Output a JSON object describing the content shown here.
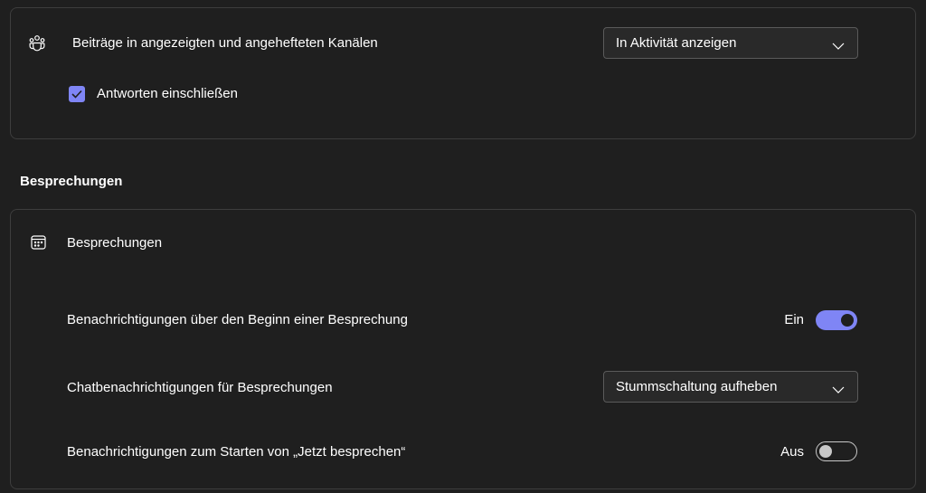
{
  "channels_card": {
    "icon": "teams-people-icon",
    "label": "Beiträge in angezeigten und angehefteten Kanälen",
    "dropdown_value": "In Aktivität anzeigen",
    "checkbox_label": "Antworten einschließen",
    "checkbox_checked": true
  },
  "meetings_section": {
    "heading": "Besprechungen",
    "card": {
      "icon": "calendar-icon",
      "title": "Besprechungen",
      "rows": [
        {
          "label": "Benachrichtigungen über den Beginn einer Besprechung",
          "state": "Ein",
          "type": "toggle",
          "on": true
        },
        {
          "label": "Chatbenachrichtigungen für Besprechungen",
          "dropdown_value": "Stummschaltung aufheben",
          "type": "dropdown"
        },
        {
          "label": "Benachrichtigungen zum Starten von „Jetzt besprechen“",
          "state": "Aus",
          "type": "toggle",
          "on": false
        }
      ]
    }
  },
  "colors": {
    "background": "#1f1f1f",
    "accent": "#7f85f5",
    "border": "#3d3d3d"
  }
}
